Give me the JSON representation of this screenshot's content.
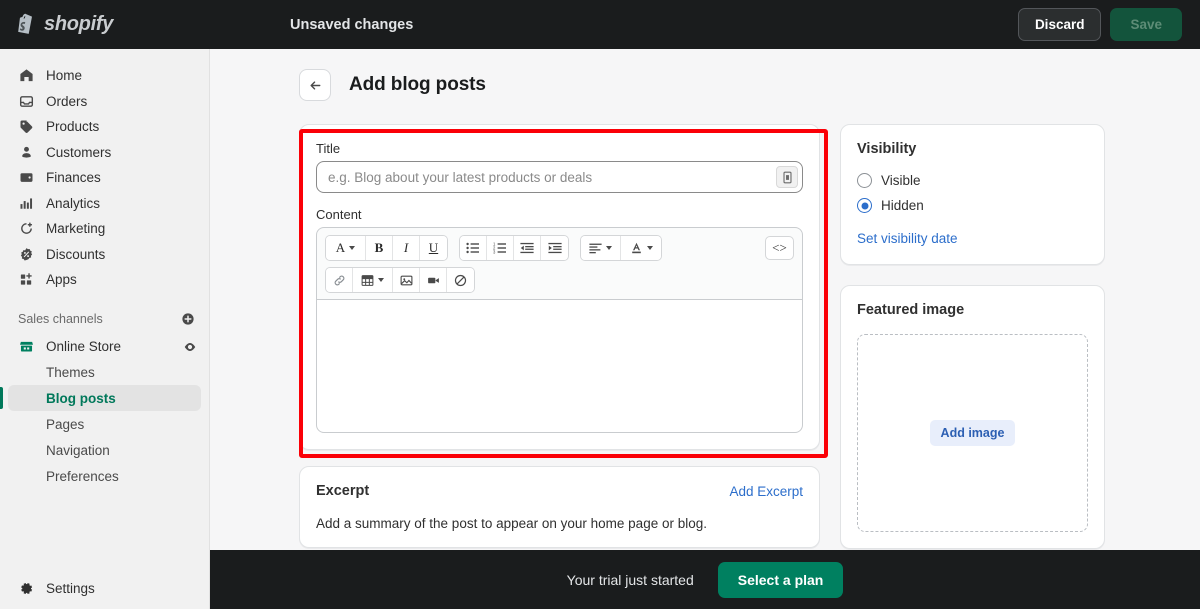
{
  "topbar": {
    "brand_name": "shopify",
    "brand_icon": "shopify-bag-logo",
    "status_text": "Unsaved changes",
    "discard_label": "Discard",
    "save_label": "Save",
    "bg_color": "#1a1c1d",
    "save_bg_color": "#13543c"
  },
  "sidebar": {
    "main_items": [
      {
        "label": "Home",
        "icon": "home-icon"
      },
      {
        "label": "Orders",
        "icon": "orders-inbox-icon"
      },
      {
        "label": "Products",
        "icon": "products-tag-icon"
      },
      {
        "label": "Customers",
        "icon": "customers-person-icon"
      },
      {
        "label": "Finances",
        "icon": "finances-wallet-icon"
      },
      {
        "label": "Analytics",
        "icon": "analytics-bars-icon"
      },
      {
        "label": "Marketing",
        "icon": "marketing-megaphone-icon"
      },
      {
        "label": "Discounts",
        "icon": "discounts-percent-icon"
      },
      {
        "label": "Apps",
        "icon": "apps-grid-icon"
      }
    ],
    "sales_channels": {
      "label": "Sales channels",
      "add_icon": "circle-plus-icon",
      "channel_label": "Online Store",
      "channel_icon": "store-icon",
      "channel_right_icon": "eye-icon",
      "sub_items": [
        {
          "label": "Themes",
          "active": false
        },
        {
          "label": "Blog posts",
          "active": true
        },
        {
          "label": "Pages",
          "active": false
        },
        {
          "label": "Navigation",
          "active": false
        },
        {
          "label": "Preferences",
          "active": false
        }
      ]
    },
    "settings": {
      "label": "Settings",
      "icon": "gear-icon"
    },
    "active_color": "#00785a"
  },
  "page": {
    "back_icon": "arrow-left-icon",
    "title": "Add blog posts"
  },
  "post_form": {
    "title_label": "Title",
    "title_value": "",
    "title_placeholder": "e.g. Blog about your latest products or deals",
    "title_suffix_icon": "expand-field-icon",
    "content_label": "Content",
    "content_value": "",
    "toolbar_row1": [
      {
        "name": "format-style-dropdown",
        "glyph": "A",
        "caret": true
      },
      {
        "name": "bold-button",
        "glyph": "B",
        "caret": false
      },
      {
        "name": "italic-button",
        "glyph": "I",
        "caret": false
      },
      {
        "name": "underline-button",
        "glyph": "U",
        "caret": false
      },
      {
        "name": "bulleted-list-button",
        "glyph": "bulleted-list-icon",
        "caret": false
      },
      {
        "name": "numbered-list-button",
        "glyph": "numbered-list-icon",
        "caret": false
      },
      {
        "name": "outdent-button",
        "glyph": "outdent-icon",
        "caret": false
      },
      {
        "name": "indent-button",
        "glyph": "indent-icon",
        "caret": false
      },
      {
        "name": "align-dropdown",
        "glyph": "align-left-icon",
        "caret": true
      },
      {
        "name": "text-color-dropdown",
        "glyph": "text-color-icon",
        "caret": true
      },
      {
        "name": "code-view-button",
        "glyph": "<>",
        "caret": false
      }
    ],
    "toolbar_row2": [
      {
        "name": "insert-link-button",
        "glyph": "link-icon",
        "caret": false
      },
      {
        "name": "insert-table-dropdown",
        "glyph": "table-icon",
        "caret": true
      },
      {
        "name": "insert-image-button",
        "glyph": "image-icon",
        "caret": false
      },
      {
        "name": "insert-video-button",
        "glyph": "video-icon",
        "caret": false
      },
      {
        "name": "clear-formatting-button",
        "glyph": "no-entry-icon",
        "caret": false
      }
    ]
  },
  "excerpt": {
    "title": "Excerpt",
    "add_link": "Add Excerpt",
    "description": "Add a summary of the post to appear on your home page or blog."
  },
  "visibility": {
    "title": "Visibility",
    "options": [
      {
        "label": "Visible",
        "selected": false
      },
      {
        "label": "Hidden",
        "selected": true
      }
    ],
    "date_link": "Set visibility date",
    "accent_color": "#2c6ecb"
  },
  "featured_image": {
    "title": "Featured image",
    "add_button": "Add image"
  },
  "trial_banner": {
    "text": "Your trial just started",
    "button": "Select a plan",
    "button_color": "#008060"
  },
  "annotation": {
    "color": "#fb0007",
    "target": "post-editor-region"
  }
}
